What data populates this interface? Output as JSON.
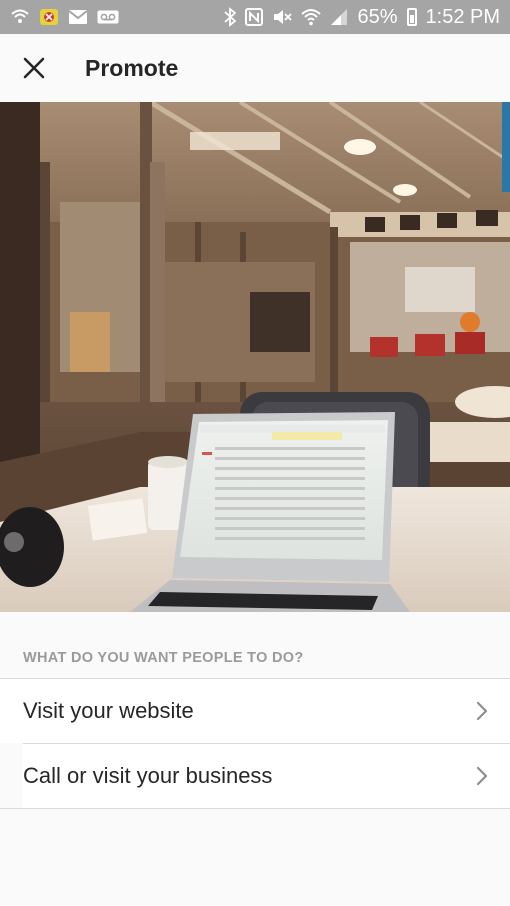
{
  "status_bar": {
    "battery_percent": "65%",
    "time": "1:52 PM",
    "icons": [
      "wifi-calling-icon",
      "app-notification-icon",
      "gmail-icon",
      "voicemail-icon",
      "bluetooth-icon",
      "nfc-icon",
      "mute-icon",
      "wifi-icon",
      "signal-icon",
      "battery-icon"
    ]
  },
  "app_bar": {
    "title": "Promote",
    "close_icon": "close-icon"
  },
  "photo": {
    "subject": "laptop on desk in office"
  },
  "question": {
    "header": "WHAT DO YOU WANT PEOPLE TO DO?",
    "options": [
      {
        "label": "Visit your website",
        "icon": "chevron-right-icon"
      },
      {
        "label": "Call or visit your business",
        "icon": "chevron-right-icon"
      }
    ]
  }
}
